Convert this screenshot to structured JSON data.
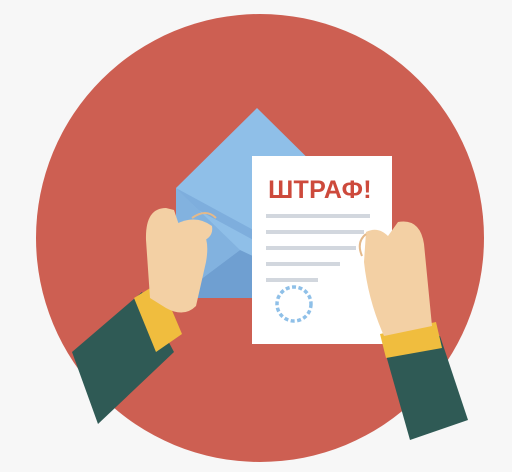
{
  "document": {
    "title": "ШТРАФ!"
  },
  "icons": {
    "envelope": "envelope-icon",
    "document": "document-icon",
    "seal": "seal-icon",
    "left_hand": "left-hand-icon",
    "right_hand": "right-hand-icon"
  },
  "colors": {
    "background": "#f7f7f7",
    "circle": "#cd5f52",
    "envelope_light": "#8fbfe8",
    "envelope_dark": "#6f9fd1",
    "paper": "#ffffff",
    "title": "#cd4a3c",
    "text_lines": "#d2d7de",
    "seal": "#8fc0e8",
    "skin": "#f3d0a4",
    "cuff": "#f0bd3e",
    "sleeve": "#2f5a55"
  }
}
